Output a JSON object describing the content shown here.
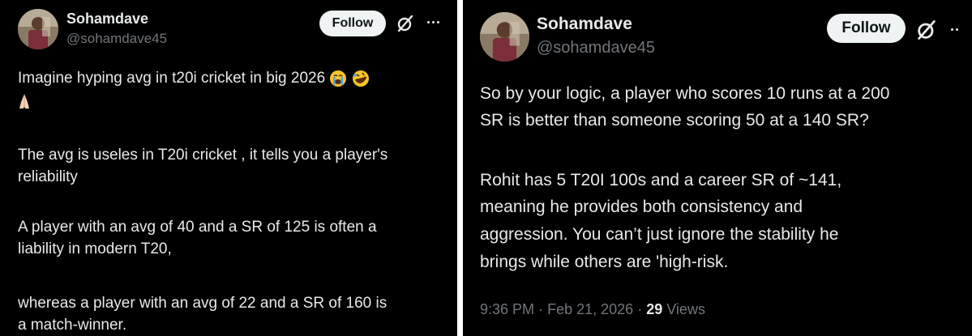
{
  "colors": {
    "background": "#000000",
    "text": "#e7e9ea",
    "muted": "#71767b",
    "follow_bg": "#eff3f4",
    "follow_text": "#0f1419"
  },
  "left_tweet": {
    "author": {
      "name": "Sohamdave",
      "handle": "@sohamdave45"
    },
    "follow_label": "Follow",
    "icons": [
      "grok-icon",
      "more-icon"
    ],
    "line1": "Imagine hyping avg in t20i cricket in big 2026",
    "emojis": [
      "loudly-crying-face-emoji",
      "rolling-on-floor-laughing-emoji",
      "folded-hands-emoji"
    ],
    "para2_line1": "The avg is useles in T20i cricket , it tells you a player's",
    "para2_line2": "reliability",
    "para3_line1": "A player with an avg of 40 and a SR of 125 is often a",
    "para3_line2": "liability in modern T20,",
    "para4_line1": "whereas a player with an avg of 22 and a SR of 160 is",
    "para4_line2": "a match-winner."
  },
  "right_tweet": {
    "author": {
      "name": "Sohamdave",
      "handle": "@sohamdave45"
    },
    "follow_label": "Follow",
    "icons": [
      "grok-icon"
    ],
    "para1_line1": "So by your logic, a player who scores 10 runs at a 200",
    "para1_line2": "SR is better than someone scoring 50 at a 140 SR?",
    "para2_line1": "Rohit has 5 T20I 100s and a career SR of ~141,",
    "para2_line2": "meaning he provides both consistency and",
    "para2_line3": "aggression. You can’t just ignore the stability he",
    "para2_line4": "brings while others are 'high-risk.",
    "time": "9:36 PM",
    "separator": "·",
    "date": "Feb 21, 2026",
    "views_count": "29",
    "views_label": "Views"
  }
}
